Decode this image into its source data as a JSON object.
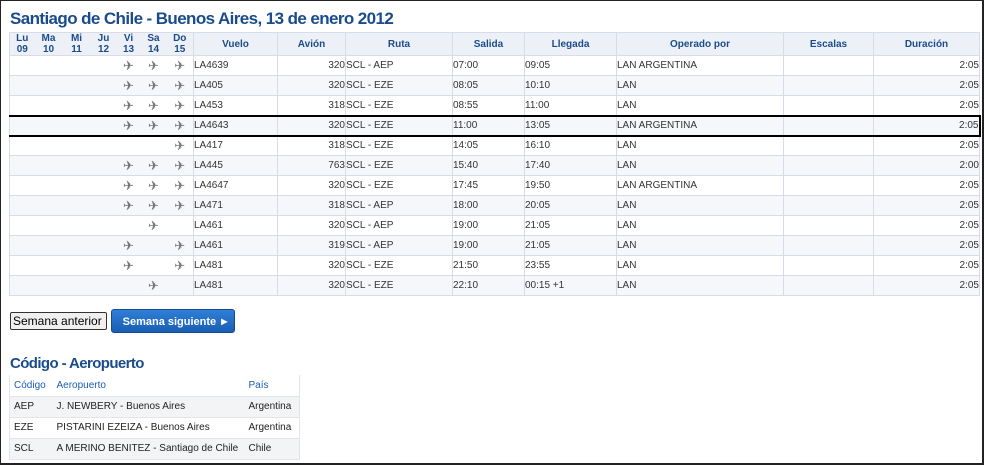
{
  "title": "Santiago de Chile - Buenos Aires, 13 de enero 2012",
  "days": [
    {
      "abbr": "Lu",
      "num": "09"
    },
    {
      "abbr": "Ma",
      "num": "10"
    },
    {
      "abbr": "Mi",
      "num": "11"
    },
    {
      "abbr": "Ju",
      "num": "12"
    },
    {
      "abbr": "Vi",
      "num": "13"
    },
    {
      "abbr": "Sa",
      "num": "14"
    },
    {
      "abbr": "Do",
      "num": "15"
    }
  ],
  "columns": {
    "vuelo": "Vuelo",
    "avion": "Avión",
    "ruta": "Ruta",
    "salida": "Salida",
    "llegada": "Llegada",
    "operado": "Operado por",
    "escalas": "Escalas",
    "duracion": "Duración"
  },
  "plane_icon": "airplane-icon",
  "flights": [
    {
      "days": [
        0,
        0,
        0,
        0,
        1,
        1,
        1
      ],
      "vuelo": "LA4639",
      "avion": "320",
      "ruta": "SCL - AEP",
      "salida": "07:00",
      "llegada": "09:05",
      "operado": "LAN ARGENTINA",
      "escalas": "",
      "duracion": "2:05"
    },
    {
      "days": [
        0,
        0,
        0,
        0,
        1,
        1,
        1
      ],
      "vuelo": "LA405",
      "avion": "320",
      "ruta": "SCL - EZE",
      "salida": "08:05",
      "llegada": "10:10",
      "operado": "LAN",
      "escalas": "",
      "duracion": "2:05"
    },
    {
      "days": [
        0,
        0,
        0,
        0,
        1,
        1,
        1
      ],
      "vuelo": "LA453",
      "avion": "318",
      "ruta": "SCL - EZE",
      "salida": "08:55",
      "llegada": "11:00",
      "operado": "LAN",
      "escalas": "",
      "duracion": "2:05"
    },
    {
      "days": [
        0,
        0,
        0,
        0,
        1,
        1,
        1
      ],
      "vuelo": "LA4643",
      "avion": "320",
      "ruta": "SCL - EZE",
      "salida": "11:00",
      "llegada": "13:05",
      "operado": "LAN ARGENTINA",
      "escalas": "",
      "duracion": "2:05",
      "selected": true
    },
    {
      "days": [
        0,
        0,
        0,
        0,
        0,
        0,
        1
      ],
      "vuelo": "LA417",
      "avion": "318",
      "ruta": "SCL - EZE",
      "salida": "14:05",
      "llegada": "16:10",
      "operado": "LAN",
      "escalas": "",
      "duracion": "2:05"
    },
    {
      "days": [
        0,
        0,
        0,
        0,
        1,
        1,
        1
      ],
      "vuelo": "LA445",
      "avion": "763",
      "ruta": "SCL - EZE",
      "salida": "15:40",
      "llegada": "17:40",
      "operado": "LAN",
      "escalas": "",
      "duracion": "2:00"
    },
    {
      "days": [
        0,
        0,
        0,
        0,
        1,
        1,
        1
      ],
      "vuelo": "LA4647",
      "avion": "320",
      "ruta": "SCL - EZE",
      "salida": "17:45",
      "llegada": "19:50",
      "operado": "LAN ARGENTINA",
      "escalas": "",
      "duracion": "2:05"
    },
    {
      "days": [
        0,
        0,
        0,
        0,
        1,
        1,
        1
      ],
      "vuelo": "LA471",
      "avion": "318",
      "ruta": "SCL - AEP",
      "salida": "18:00",
      "llegada": "20:05",
      "operado": "LAN",
      "escalas": "",
      "duracion": "2:05"
    },
    {
      "days": [
        0,
        0,
        0,
        0,
        0,
        1,
        0
      ],
      "vuelo": "LA461",
      "avion": "320",
      "ruta": "SCL - AEP",
      "salida": "19:00",
      "llegada": "21:05",
      "operado": "LAN",
      "escalas": "",
      "duracion": "2:05"
    },
    {
      "days": [
        0,
        0,
        0,
        0,
        1,
        0,
        1
      ],
      "vuelo": "LA461",
      "avion": "319",
      "ruta": "SCL - AEP",
      "salida": "19:00",
      "llegada": "21:05",
      "operado": "LAN",
      "escalas": "",
      "duracion": "2:05"
    },
    {
      "days": [
        0,
        0,
        0,
        0,
        1,
        0,
        1
      ],
      "vuelo": "LA481",
      "avion": "320",
      "ruta": "SCL - EZE",
      "salida": "21:50",
      "llegada": "23:55",
      "operado": "LAN",
      "escalas": "",
      "duracion": "2:05"
    },
    {
      "days": [
        0,
        0,
        0,
        0,
        0,
        1,
        0
      ],
      "vuelo": "LA481",
      "avion": "320",
      "ruta": "SCL - EZE",
      "salida": "22:10",
      "llegada": "00:15 +1",
      "operado": "LAN",
      "escalas": "",
      "duracion": "2:05"
    }
  ],
  "buttons": {
    "prev": "Semana anterior",
    "next": "Semana siguiente"
  },
  "airports": {
    "title": "Código - Aeropuerto",
    "headers": {
      "codigo": "Código",
      "aeropuerto": "Aeropuerto",
      "pais": "País"
    },
    "rows": [
      {
        "codigo": "AEP",
        "aeropuerto": "J. NEWBERY - Buenos Aires",
        "pais": "Argentina"
      },
      {
        "codigo": "EZE",
        "aeropuerto": "PISTARINI EZEIZA - Buenos Aires",
        "pais": "Argentina"
      },
      {
        "codigo": "SCL",
        "aeropuerto": "A MERINO BENITEZ - Santiago de Chile",
        "pais": "Chile"
      }
    ]
  },
  "colors": {
    "heading": "#1a4c8c",
    "button_primary": "#1a5eb5",
    "header_bg": "#edf1f7"
  }
}
